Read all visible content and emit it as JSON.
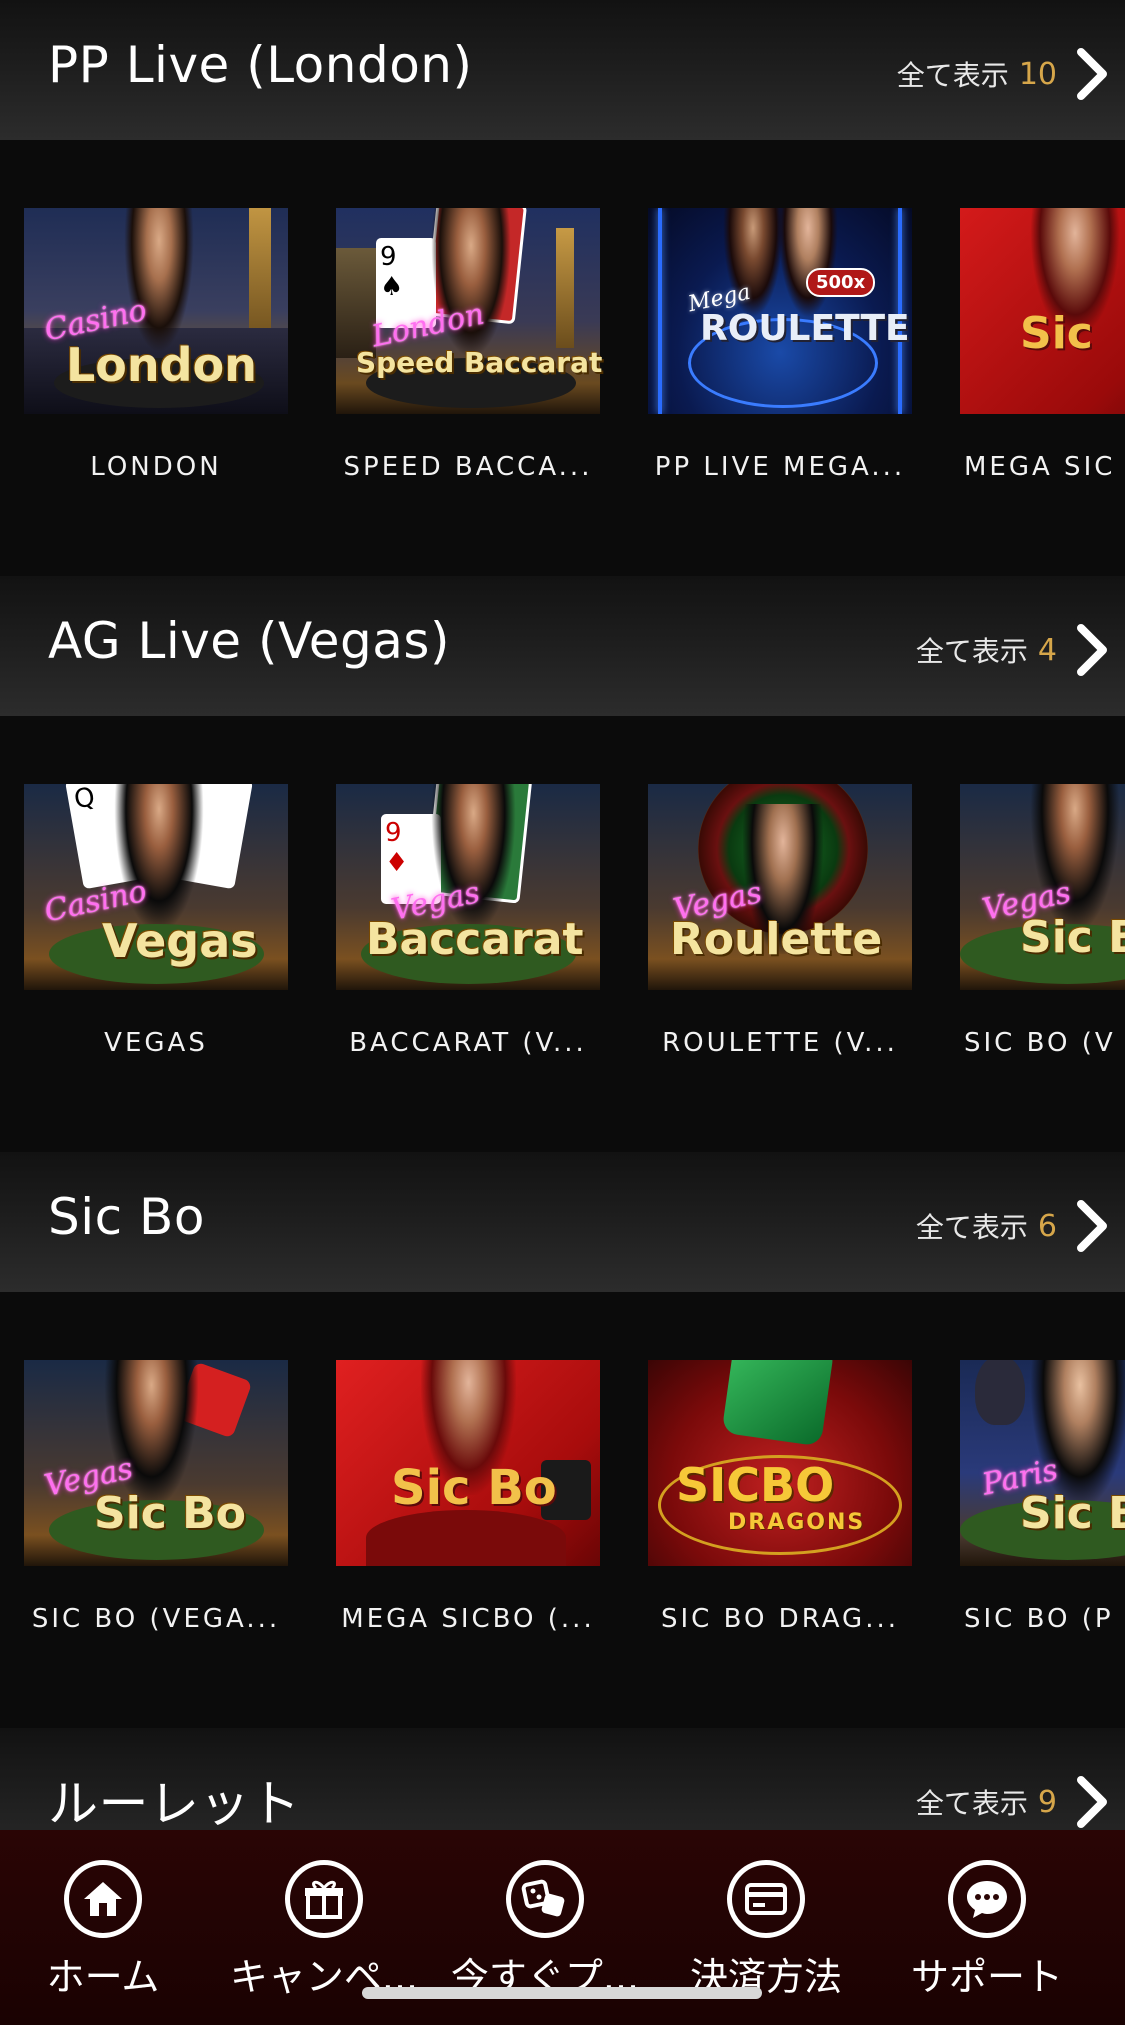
{
  "sections": [
    {
      "title": "PP Live (London)",
      "view_all_label": "全て表示",
      "count": "10",
      "games": [
        {
          "name": "LONDON",
          "neon": "Casino",
          "logo": "London"
        },
        {
          "name": "SPEED BACCA...",
          "neon": "London",
          "logo": "Speed Baccarat"
        },
        {
          "name": "PP LIVE MEGA...",
          "neon": "Mega",
          "logo": "ROULETTE",
          "badge": "500x"
        },
        {
          "name": "MEGA SIC",
          "neon": "",
          "logo": "Sic"
        }
      ]
    },
    {
      "title": "AG Live (Vegas)",
      "view_all_label": "全て表示",
      "count": "4",
      "games": [
        {
          "name": "VEGAS",
          "neon": "Casino",
          "logo": "Vegas"
        },
        {
          "name": "BACCARAT (V...",
          "neon": "Vegas",
          "logo": "Baccarat"
        },
        {
          "name": "ROULETTE (V...",
          "neon": "Vegas",
          "logo": "Roulette"
        },
        {
          "name": "SIC BO (V",
          "neon": "Vegas",
          "logo": "Sic B"
        }
      ]
    },
    {
      "title": "Sic Bo",
      "view_all_label": "全て表示",
      "count": "6",
      "games": [
        {
          "name": "SIC BO (VEGA...",
          "neon": "Vegas",
          "logo": "Sic Bo"
        },
        {
          "name": "MEGA SICBO (...",
          "neon": "",
          "logo": "Sic Bo"
        },
        {
          "name": "SIC BO DRAG...",
          "neon": "",
          "logo": "SICBO",
          "sublogo": "DRAGONS"
        },
        {
          "name": "SIC BO (P",
          "neon": "Paris",
          "logo": "Sic B"
        }
      ]
    },
    {
      "title": "ルーレット",
      "view_all_label": "全て表示",
      "count": "9",
      "games": []
    }
  ],
  "bottom_nav": [
    {
      "label": "ホーム",
      "icon": "home-icon"
    },
    {
      "label": "キャンペ...",
      "icon": "gift-icon"
    },
    {
      "label": "今すぐプ...",
      "icon": "dice-icon"
    },
    {
      "label": "決済方法",
      "icon": "credit-card-icon"
    },
    {
      "label": "サポート",
      "icon": "chat-icon"
    }
  ],
  "colors": {
    "accent_count": "#d6a64a",
    "nav_bg": "#2a0505",
    "page_bg": "#0b0b0b"
  }
}
